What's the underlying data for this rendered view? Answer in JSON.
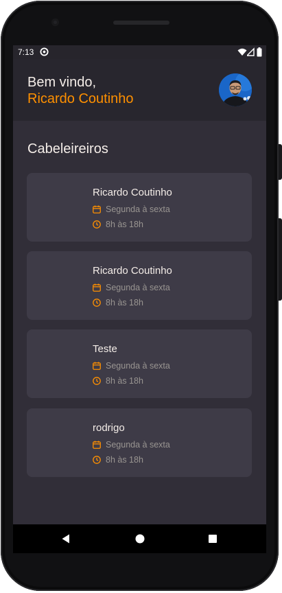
{
  "status_bar": {
    "time": "7:13",
    "app_icon": "sync-circle-icon",
    "wifi_icon": "wifi-icon",
    "signal_icon": "cell-signal-icon",
    "battery_icon": "battery-icon"
  },
  "header": {
    "greeting": "Bem vindo,",
    "user_name": "Ricardo Coutinho",
    "avatar_icon": "user-avatar"
  },
  "section": {
    "title": "Cabeleireiros"
  },
  "providers": [
    {
      "name": "Ricardo Coutinho",
      "days": "Segunda à sexta",
      "hours": "8h às 18h"
    },
    {
      "name": "Ricardo Coutinho",
      "days": "Segunda à sexta",
      "hours": "8h às 18h"
    },
    {
      "name": "Teste",
      "days": "Segunda à sexta",
      "hours": "8h às 18h"
    },
    {
      "name": "rodrigo",
      "days": "Segunda à sexta",
      "hours": "8h às 18h"
    }
  ],
  "navigation": {
    "back_icon": "back-triangle-icon",
    "home_icon": "home-circle-icon",
    "recents_icon": "recents-square-icon"
  },
  "colors": {
    "accent": "#ff9000",
    "background": "#312e38",
    "header_bg": "#28262e",
    "card_bg": "#3e3b47",
    "text": "#f4ede8",
    "muted_text": "#999591"
  }
}
